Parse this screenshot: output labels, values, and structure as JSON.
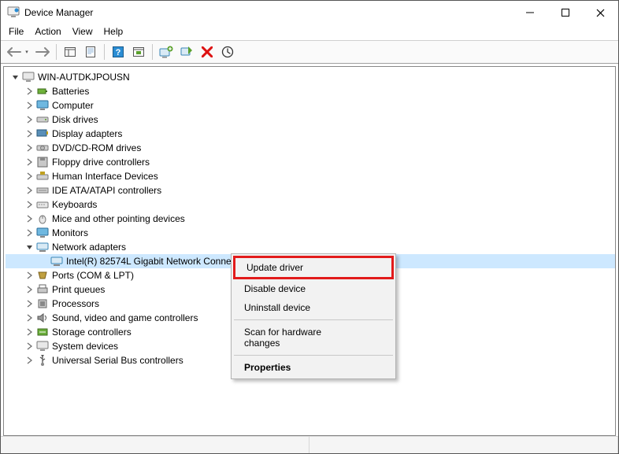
{
  "window": {
    "title": "Device Manager"
  },
  "menubar": {
    "file": "File",
    "action": "Action",
    "view": "View",
    "help": "Help"
  },
  "tree": {
    "root": "WIN-AUTDKJPOUSN",
    "batteries": "Batteries",
    "computer": "Computer",
    "diskdrives": "Disk drives",
    "displayadapters": "Display adapters",
    "dvdcdrom": "DVD/CD-ROM drives",
    "floppy": "Floppy drive controllers",
    "hid": "Human Interface Devices",
    "ide": "IDE ATA/ATAPI controllers",
    "keyboards": "Keyboards",
    "mice": "Mice and other pointing devices",
    "monitors": "Monitors",
    "netadapters": "Network adapters",
    "netcard": "Intel(R) 82574L Gigabit Network Connection",
    "ports": "Ports (COM & LPT)",
    "printqueues": "Print queues",
    "processors": "Processors",
    "sound": "Sound, video and game controllers",
    "storage": "Storage controllers",
    "sysdevices": "System devices",
    "usb": "Universal Serial Bus controllers"
  },
  "contextmenu": {
    "update": "Update driver",
    "disable": "Disable device",
    "uninstall": "Uninstall device",
    "scan": "Scan for hardware changes",
    "properties": "Properties"
  }
}
